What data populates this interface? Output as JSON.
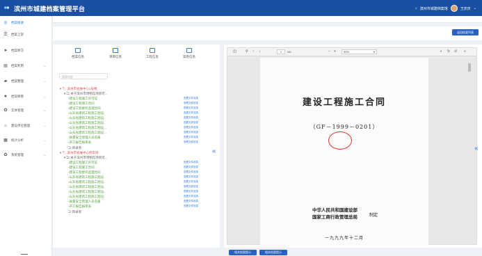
{
  "header": {
    "app_title": "滨州市城建档案管理平台",
    "org_text": "滨州市城建档案馆",
    "user_name": "王庆庆"
  },
  "sidebar": {
    "items": [
      {
        "label": "档案接收",
        "icon": "check-circle-icon",
        "active": true,
        "has_chevron": false
      },
      {
        "label": "档案上架",
        "icon": "shelf-icon",
        "active": false,
        "has_chevron": false
      },
      {
        "label": "档案移交",
        "icon": "send-icon",
        "active": false,
        "has_chevron": false
      },
      {
        "label": "档案利用",
        "icon": "book-icon",
        "active": false,
        "has_chevron": true
      },
      {
        "label": "档案整理",
        "icon": "folder-icon",
        "active": false,
        "has_chevron": true
      },
      {
        "label": "档案保管",
        "icon": "star-icon",
        "active": false,
        "has_chevron": true
      },
      {
        "label": "实体管理",
        "icon": "settings-icon",
        "active": false,
        "has_chevron": true
      },
      {
        "label": "建设单位管理",
        "icon": "building-icon",
        "active": false,
        "has_chevron": true
      },
      {
        "label": "统计分析",
        "icon": "chart-icon",
        "active": false,
        "has_chevron": true
      },
      {
        "label": "系统管理",
        "icon": "gear-icon",
        "active": false,
        "has_chevron": true
      }
    ]
  },
  "toolbar": {
    "return_button": "返回档案列表"
  },
  "left_tabs": [
    {
      "label": "档案信息"
    },
    {
      "label": "项目信息"
    },
    {
      "label": "工程信息"
    },
    {
      "label": "案卷信息"
    }
  ],
  "search": {
    "placeholder": "搜索内容"
  },
  "tree": {
    "groups": [
      {
        "title": "滨州市会展中心1号楼",
        "subtitle": "关于滨州市博物馆项目可...",
        "items": [
          {
            "label": "建设工程施工许可证",
            "action": "查看文件信息"
          },
          {
            "label": "建设工程施工合同",
            "action": "查看文件信息"
          },
          {
            "label": "建设工程委托监理合同",
            "action": "查看文件信息"
          },
          {
            "label": "山东省建筑工程施工图设...",
            "action": "查看文件信息"
          },
          {
            "label": "山东省建筑工程施工图设...",
            "action": "查看文件信息"
          },
          {
            "label": "山东省建筑工程施工图设...",
            "action": "查看文件信息"
          },
          {
            "label": "山东省建筑工程施工图设...",
            "action": "查看文件信息"
          },
          {
            "label": "山东省建筑工程施工图设...",
            "action": "查看文件信息"
          },
          {
            "label": "质量安全管理人员名册",
            "action": "查看文件信息"
          },
          {
            "label": "开工报告报审表",
            "action": "查看文件信息"
          }
        ],
        "footer": "目录卷"
      },
      {
        "title": "滨州市会展中心停车场",
        "subtitle": "关于滨州市博物馆项目可...",
        "items": [
          {
            "label": "建设工程施工许可证",
            "action": "查看文件信息"
          },
          {
            "label": "建设工程施工合同",
            "action": "查看文件信息"
          },
          {
            "label": "建设工程委托监理合同",
            "action": "查看文件信息"
          },
          {
            "label": "山东省建筑工程施工图设...",
            "action": "查看文件信息"
          },
          {
            "label": "山东省建筑工程施工图设...",
            "action": "查看文件信息"
          },
          {
            "label": "山东省建筑工程施工图设...",
            "action": "查看文件信息"
          },
          {
            "label": "山东省建筑工程施工图设...",
            "action": "查看文件信息"
          },
          {
            "label": "山东省建筑工程施工图设...",
            "action": "查看文件信息"
          },
          {
            "label": "质量安全管理人员名册",
            "action": "查看文件信息"
          },
          {
            "label": "开工报告报审表",
            "action": "查看文件信息"
          }
        ],
        "footer": "目录卷"
      }
    ]
  },
  "viewer": {
    "page_current": "1",
    "page_total": "/40",
    "zoom": "90%",
    "document": {
      "title": "建设工程施工合同",
      "code": "（GF－1999－0201）",
      "issuer_line1": "中华人民共和国建设部",
      "issuer_line2": "国家工商行政管理总局",
      "issuer_suffix": "制定",
      "date": "一九九九年十二月"
    }
  },
  "bottom_buttons": {
    "prev": "相关档案提示",
    "next": "相关档案提示"
  },
  "colors": {
    "brand": "#1a4fa3",
    "accent": "#2a7be4",
    "tree_title": "#e04a4a",
    "tree_item": "#52a33a",
    "seal": "#d83030"
  }
}
